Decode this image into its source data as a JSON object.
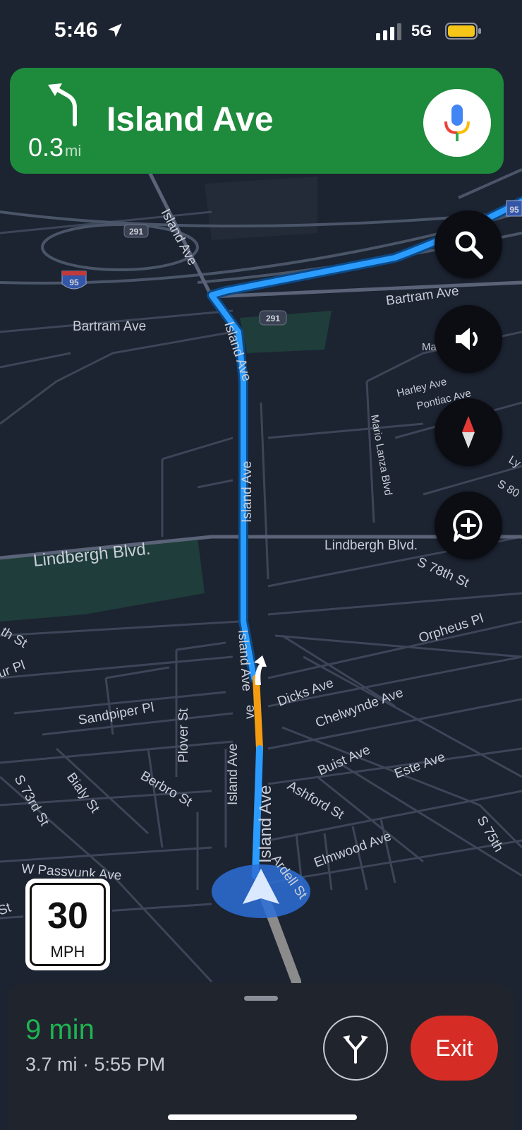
{
  "status_bar": {
    "time": "5:46",
    "network": "5G",
    "battery_color": "#f5c518"
  },
  "navigation": {
    "instruction_icon": "turn-left-arrow-icon",
    "distance_value": "0.3",
    "distance_unit": "mi",
    "street": "Island Ave"
  },
  "map": {
    "labels": {
      "bartram_ave_left": "Bartram Ave",
      "bartram_ave_right": "Bartram Ave",
      "island_ave_1": "Island Ave",
      "island_ave_2": "Island Ave",
      "island_ave_3": "Island Ave",
      "island_ave_4": "Island Ave",
      "island_ave_5": "Island Ave",
      "island_ave_6": "Island Ave",
      "lindbergh_blvd_left": "Lindbergh Blvd.",
      "lindbergh_blvd_right": "Lindbergh Blvd.",
      "s78th_st": "S 78th St",
      "orpheus_pl": "Orpheus Pl",
      "dicks_ave": "Dicks Ave",
      "chelwynde_ave": "Chelwynde Ave",
      "buist_ave": "Buist Ave",
      "este_ave": "Este Ave",
      "sandpiper_pl": "Sandpiper Pl",
      "plover_st": "Plover St",
      "berbro_st": "Berbro St",
      "ashford_st": "Ashford St",
      "elmwood_ave": "Elmwood Ave",
      "s75th": "S 75th",
      "s73rd_st": "S 73rd St",
      "bialy_st": "Bialy St",
      "w_passyunk_ave": "W Passyunk Ave",
      "ardell_st": "Ardell St",
      "harley_ave": "Harley Ave",
      "pontiac_ave": "Pontiac Ave",
      "mario_lanza_blvd": "Mario Lanza Blvd",
      "ma": "Ma",
      "ly": "Ly",
      "s80": "S 80",
      "th_st": "th St",
      "ur_pl": "ur Pl",
      "st": "St",
      "ve": "ve"
    },
    "shields": {
      "route_291_a": "291",
      "route_291_b": "291",
      "interstate_95_a": "95",
      "interstate_95_b": "95"
    }
  },
  "controls": {
    "search_icon": "search-icon",
    "sound_icon": "volume-icon",
    "compass_icon": "compass-icon",
    "report_icon": "add-report-icon"
  },
  "speed_limit": {
    "value": "30",
    "unit": "MPH"
  },
  "trip": {
    "duration": "9 min",
    "details": "3.7 mi · 5:55 PM",
    "exit_label": "Exit",
    "duration_color": "#1fb452",
    "exit_color": "#d52d26",
    "route_color": "#2b9cff",
    "banner_color": "#1e8a3c"
  }
}
